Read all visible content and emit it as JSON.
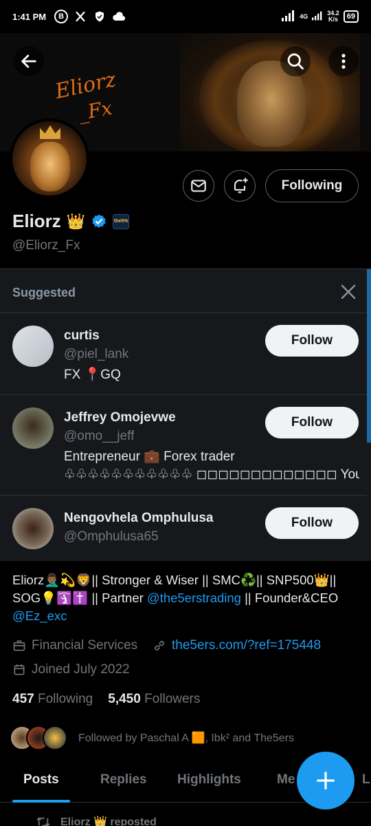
{
  "status_bar": {
    "time": "1:41 PM",
    "network_type": "4G",
    "network_speed": "34.2",
    "network_unit": "K/s",
    "battery": "69"
  },
  "banner": {
    "brand_line1": "Eliorz",
    "brand_line2": "_Fx"
  },
  "profile": {
    "name": "Eliorz",
    "name_emoji": "👑",
    "handle": "@Eliorz_Fx",
    "affiliate_badge_text": "the5%",
    "following_button": "Following"
  },
  "suggested": {
    "title": "Suggested",
    "items": [
      {
        "name": "curtis",
        "handle": "@piel_lank",
        "bio": "FX  📍GQ",
        "bio2": "",
        "follow": "Follow"
      },
      {
        "name": "Jeffrey Omojevwe",
        "handle": "@omo__jeff",
        "bio": "Entrepreneur 💼  Forex trader",
        "bio2": "♧♧♧♧♧♧♧♧♧♧♧ ◻◻◻◻◻◻◻◻◻◻◻◻◻ You must ...",
        "follow": "Follow"
      },
      {
        "name": "Nengovhela Omphulusa",
        "handle": "@Omphulusa65",
        "bio": "",
        "bio2": "",
        "follow": "Follow"
      }
    ]
  },
  "bio": {
    "part1": "Eliorz🤦🏾‍♂️💫🦁|| Stronger & Wiser || SMC♻️|| SNP500👑|| SOG💡🛐✝️ || Partner ",
    "mention1": "@the5erstrading",
    "part2": " || Founder&CEO",
    "mention2": "@Ez_exc"
  },
  "meta": {
    "category": "Financial Services",
    "website": "the5ers.com/?ref=175448",
    "joined": "Joined July 2022"
  },
  "counts": {
    "following_num": "457",
    "following_label": "Following",
    "followers_num": "5,450",
    "followers_label": "Followers"
  },
  "followed_by": "Followed by Paschal A 🟧, Ibk² and The5ers",
  "tabs": [
    "Posts",
    "Replies",
    "Highlights",
    "Me",
    "Li"
  ],
  "repost": "Eliorz 👑 reposted",
  "colors": {
    "accent": "#1d9bf0",
    "background": "#000000",
    "card": "#16181c"
  }
}
